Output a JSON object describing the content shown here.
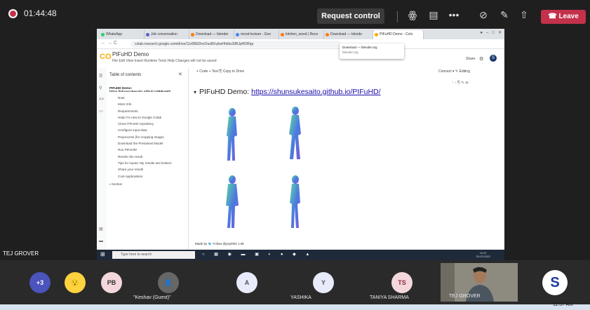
{
  "teams": {
    "record_time": "01:44:48",
    "request_control": "Request control",
    "leave": "Leave",
    "icons": [
      "participants-icon",
      "chat-icon",
      "more-icon",
      "camera-off-icon",
      "mic-off-icon",
      "share-icon",
      "phone-icon"
    ]
  },
  "browser": {
    "tabs": [
      {
        "label": "WhatsApp",
        "color": "#25d366"
      },
      {
        "label": "Job conversation",
        "color": "#5b5fc7"
      },
      {
        "label": "Download — blender",
        "color": "#ff7a00"
      },
      {
        "label": "mood texture - Goo",
        "color": "#4285f4"
      },
      {
        "label": "kitchen_wood | Reco",
        "color": "#ff7a00"
      },
      {
        "label": "Download — blende",
        "color": "#ff7a00"
      },
      {
        "label": "PIFuHD Demo - Colo",
        "color": "#f9ab00"
      }
    ],
    "url": "colab.research.google.com/drive/11z5BEDnxOuoBil-pkaHhbkz39BJpHDRtgr",
    "tooltip_title": "Download — blender.org",
    "tooltip_sub": "blender.org"
  },
  "colab": {
    "logo": "CO",
    "title": "PIFuHD Demo",
    "menu": "File  Edit  View  Insert  Runtime  Tools  Help   Changes will not be saved",
    "share": "Share",
    "avatar": "S",
    "toc_title": "Table of contents",
    "toc_items": [
      {
        "label": "PIFuHD Demo: https://shunsukesaito.github.io/PIFuHD/",
        "head": true
      },
      {
        "label": "Note"
      },
      {
        "label": "More Info"
      },
      {
        "label": "Requirements"
      },
      {
        "label": "Help! I'm new to Google Colab"
      },
      {
        "label": "Clone PIFuHD repository"
      },
      {
        "label": "Configure input data"
      },
      {
        "label": "Preprocess (for cropping image)"
      },
      {
        "label": "Download the Pretrained Model"
      },
      {
        "label": "Run PIFuHD!"
      },
      {
        "label": "Render the result"
      },
      {
        "label": "Tips for inputs: My results are broken!"
      },
      {
        "label": "Share your result!"
      },
      {
        "label": "Cool Applications"
      }
    ],
    "section": "Section",
    "toolbar": "+ Code   + Text    ⎘ Copy to Drive",
    "connect": "Connect  ▾      ✎ Editing",
    "demo_prefix": "PIFuHD Demo: ",
    "demo_link": "https://shunsukesaito.github.io/PIFuHD/",
    "made_by": "Made by  🐦 Follow @psyth91   1.8k"
  },
  "inner_taskbar": {
    "search": "Type here to search",
    "clock_time": "11:37",
    "clock_date": "20-03-2021"
  },
  "sharer": "TEJ GROVER",
  "participants": [
    {
      "initials": "+3",
      "color": "#4b53bc",
      "name": ""
    },
    {
      "initials": "😯",
      "color": "#ffd23f",
      "name": ""
    },
    {
      "initials": "PB",
      "color": "#f4d7dc",
      "text_color": "#333",
      "name": ""
    },
    {
      "initials": "👤",
      "color": "#666666",
      "name": "\"Keshav (Guest)\""
    },
    {
      "initials": "A",
      "color": "#e8ebfa",
      "text_color": "#555",
      "name": ""
    },
    {
      "initials": "Y",
      "color": "#e8ebfa",
      "text_color": "#555",
      "name": "YASHIKA"
    },
    {
      "initials": "TS",
      "color": "#f4d7dc",
      "text_color": "#8a2b3b",
      "name": "TANIYA SHARMA"
    },
    {
      "initials": "S",
      "color": "#ffffff",
      "text_color": "#1a3a9c",
      "name": ""
    }
  ],
  "video_name": "TEJ GROVER",
  "win_clock": "11:37 AM"
}
